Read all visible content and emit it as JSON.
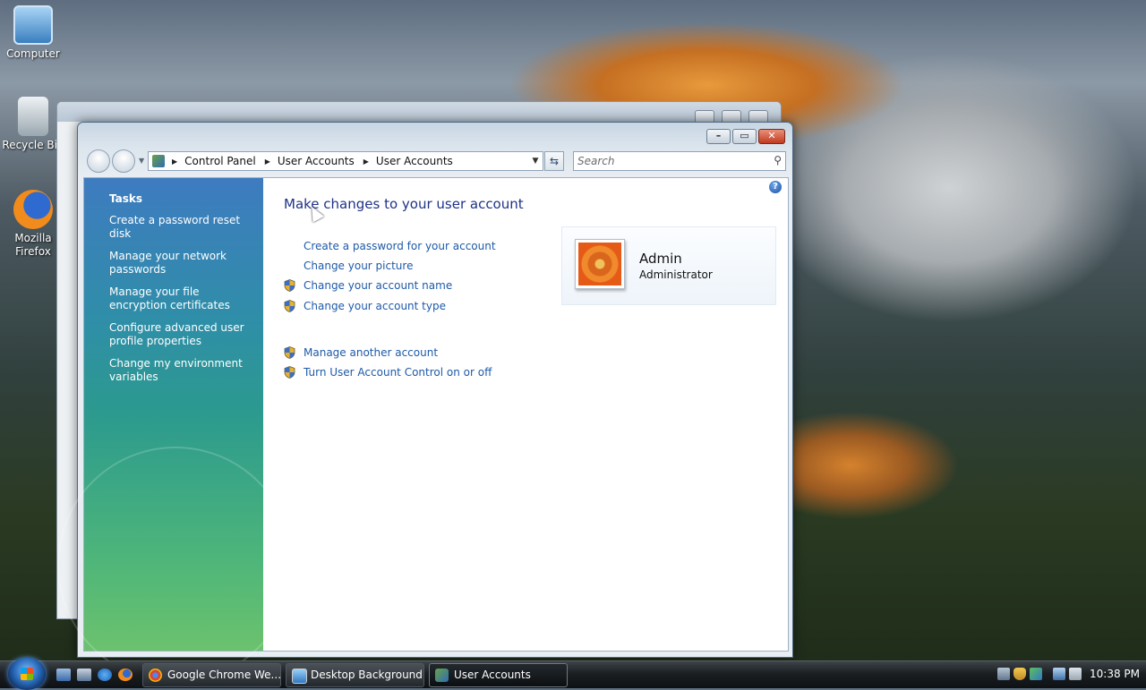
{
  "desktop": {
    "icons": [
      {
        "label": "Computer"
      },
      {
        "label": "Recycle Bin"
      },
      {
        "label": "Mozilla Firefox"
      }
    ]
  },
  "window": {
    "title": "User Accounts",
    "breadcrumb": [
      "Control Panel",
      "User Accounts",
      "User Accounts"
    ],
    "search_placeholder": "Search",
    "help_symbol": "?",
    "tasks": {
      "heading": "Tasks",
      "items": [
        "Create a password reset disk",
        "Manage your network passwords",
        "Manage your file encryption certificates",
        "Configure advanced user profile properties",
        "Change my environment variables"
      ]
    },
    "main": {
      "heading": "Make changes to your user account",
      "links": [
        {
          "label": "Create a password for your account",
          "shield": false
        },
        {
          "label": "Change your picture",
          "shield": false
        },
        {
          "label": "Change your account name",
          "shield": true
        },
        {
          "label": "Change your account type",
          "shield": true
        },
        {
          "label": "Manage another account",
          "shield": true
        },
        {
          "label": "Turn User Account Control on or off",
          "shield": true
        }
      ]
    },
    "account": {
      "name": "Admin",
      "role": "Administrator"
    }
  },
  "taskbar": {
    "buttons": [
      {
        "label": "Google Chrome We...",
        "icon": "chrome-icon"
      },
      {
        "label": "Desktop Background",
        "icon": "desktop-background-icon"
      },
      {
        "label": "User Accounts",
        "icon": "user-accounts-icon"
      }
    ],
    "clock": "10:38 PM"
  },
  "colors": {
    "link": "#1e5aa8",
    "heading": "#1e3287",
    "tasks_top": "#3e7bc0",
    "tasks_bottom": "#6bc26d"
  }
}
